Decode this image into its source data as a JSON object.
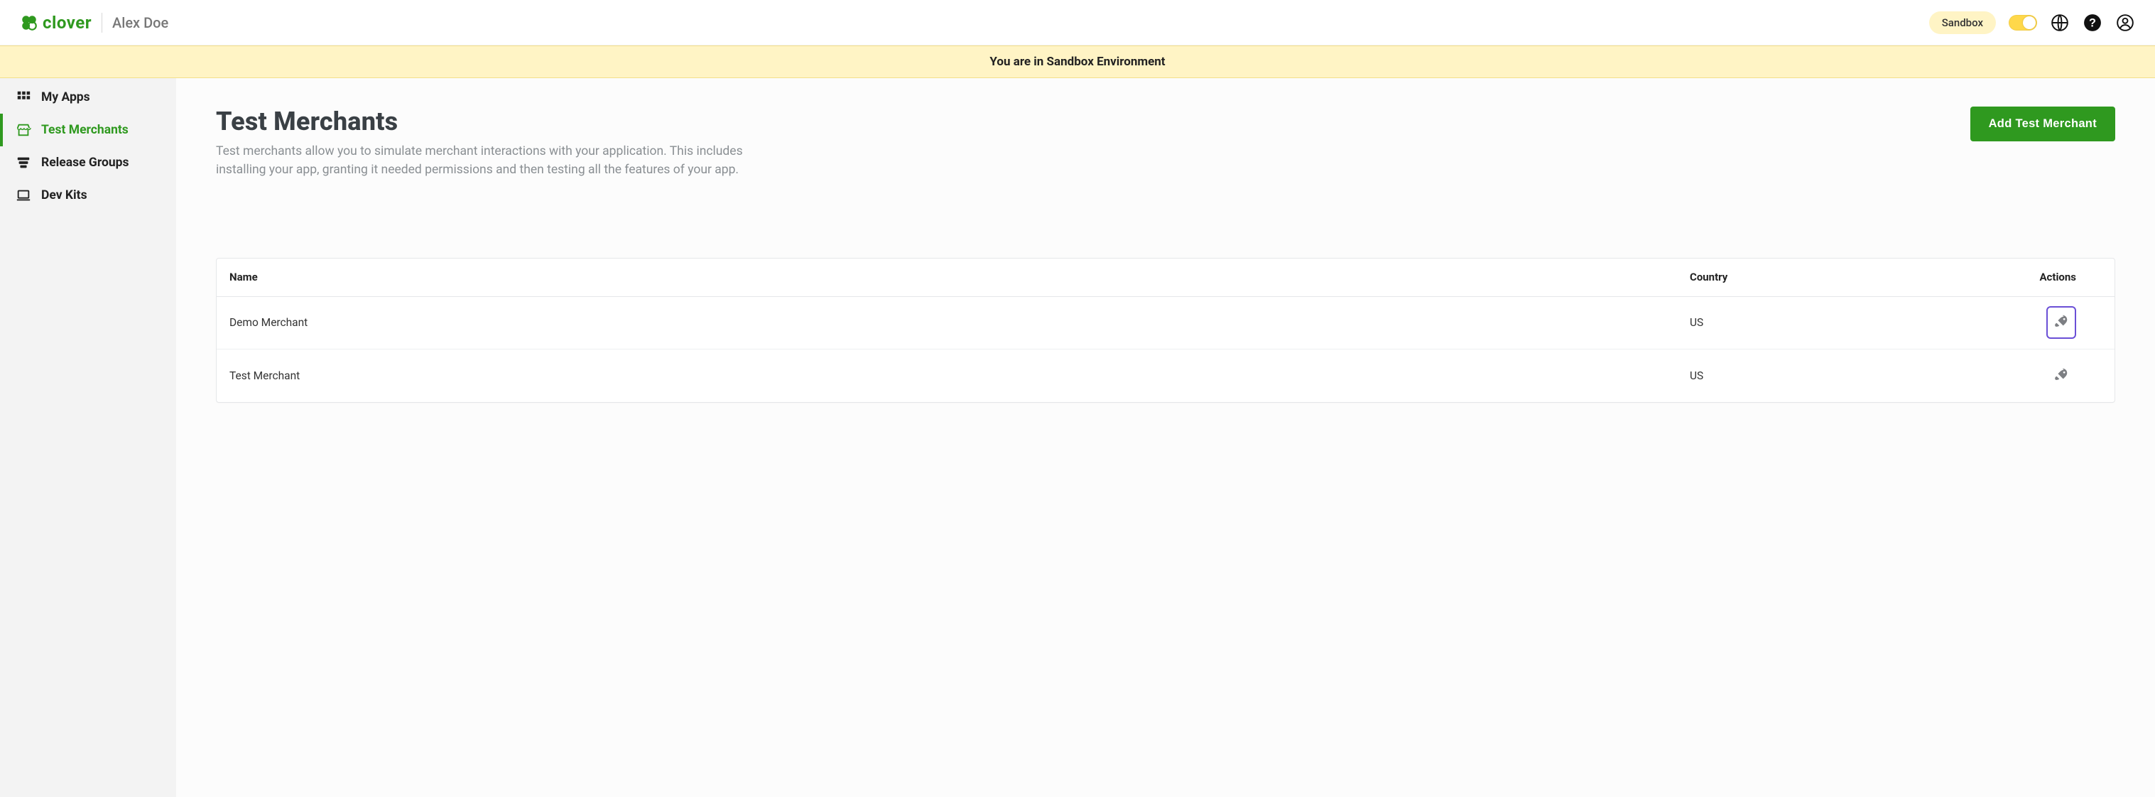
{
  "brand": {
    "name": "clover"
  },
  "user": {
    "display_name": "Alex Doe"
  },
  "header": {
    "env_label": "Sandbox"
  },
  "banner": {
    "message": "You are in Sandbox Environment"
  },
  "sidebar": {
    "items": [
      {
        "label": "My Apps",
        "icon": "grid-icon",
        "active": false
      },
      {
        "label": "Test Merchants",
        "icon": "storefront-icon",
        "active": true
      },
      {
        "label": "Release Groups",
        "icon": "stack-icon",
        "active": false
      },
      {
        "label": "Dev Kits",
        "icon": "laptop-icon",
        "active": false
      }
    ]
  },
  "page": {
    "title": "Test Merchants",
    "description": "Test merchants allow you to simulate merchant interactions with your application. This includes installing your app, granting it needed permissions and then testing all the features of your app.",
    "primary_action_label": "Add Test Merchant"
  },
  "table": {
    "columns": {
      "name": "Name",
      "country": "Country",
      "actions": "Actions"
    },
    "rows": [
      {
        "name": "Demo Merchant",
        "country": "US",
        "highlighted_action": true
      },
      {
        "name": "Test Merchant",
        "country": "US",
        "highlighted_action": false
      }
    ]
  }
}
